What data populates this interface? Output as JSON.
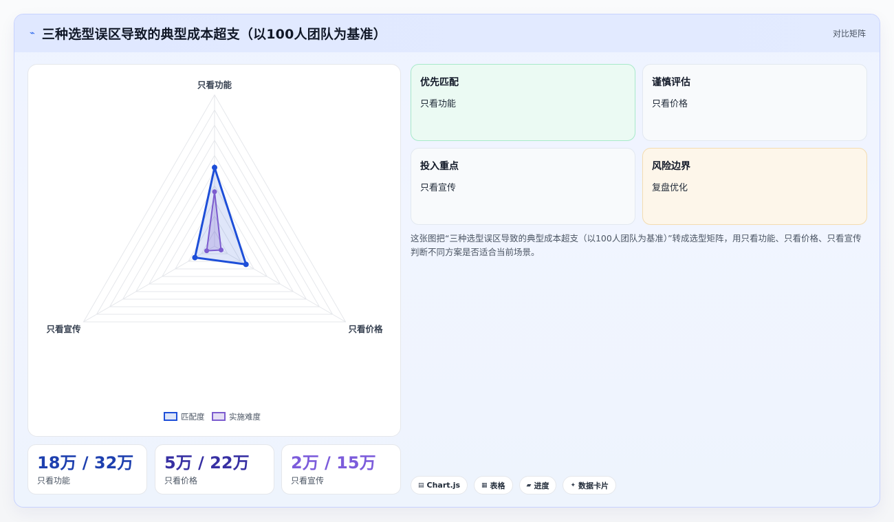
{
  "header": {
    "icon": "zap-icon",
    "title": "三种选型误区导致的典型成本超支（以100人团队为基准）",
    "tag": "对比矩阵"
  },
  "chart_data": {
    "type": "radar",
    "axes": [
      "只看功能",
      "只看价格",
      "只看宣传"
    ],
    "range": [
      0,
      10
    ],
    "grid": true,
    "legend_position": "bottom",
    "series": [
      {
        "name": "匹配度",
        "values": [
          5.2,
          2.4,
          1.5
        ],
        "color": "#1d4ed8"
      },
      {
        "name": "实施难度",
        "values": [
          3.6,
          0.5,
          0.6
        ],
        "color": "#7c5ccf"
      }
    ]
  },
  "stats": [
    {
      "value": "18万 / 32万",
      "label": "只看功能",
      "color": "#1e40af"
    },
    {
      "value": "5万 / 22万",
      "label": "只看价格",
      "color": "#3730a3"
    },
    {
      "value": "2万 / 15万",
      "label": "只看宣传",
      "color": "#7c5cdb"
    }
  ],
  "boxes": [
    {
      "title": "优先匹配",
      "sub": "只看功能",
      "bg": "#ebfaf3",
      "border": "#a7e9c9"
    },
    {
      "title": "谨慎评估",
      "sub": "只看价格",
      "bg": "#f8fafc",
      "border": "#e2e8f0"
    },
    {
      "title": "投入重点",
      "sub": "只看宣传",
      "bg": "#f8fafc",
      "border": "#e2e8f0"
    },
    {
      "title": "风险边界",
      "sub": "复盘优化",
      "bg": "#fdf6ea",
      "border": "#f3dcb0"
    }
  ],
  "description": "这张图把“三种选型误区导致的典型成本超支（以100人团队为基准）”转成选型矩阵，用只看功能、只看价格、只看宣传判断不同方案是否适合当前场景。",
  "chips": [
    {
      "icon": "chart-icon",
      "glyph": "▤",
      "label": "Chart.js"
    },
    {
      "icon": "table-icon",
      "glyph": "▦",
      "label": "表格"
    },
    {
      "icon": "progress-icon",
      "glyph": "▰",
      "label": "进度"
    },
    {
      "icon": "card-icon",
      "glyph": "✦",
      "label": "数据卡片"
    }
  ]
}
